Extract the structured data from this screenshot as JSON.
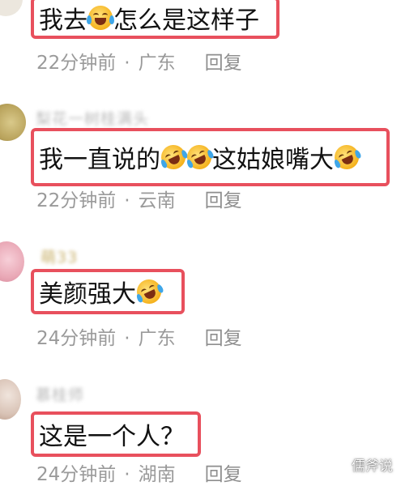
{
  "comments": [
    {
      "username": "",
      "text_before": "我去",
      "text_after": "怎么是这样子",
      "time": "22分钟前",
      "location": "广东",
      "reply_label": "回复"
    },
    {
      "username": "梨花一树桂满头",
      "text_before": "我一直说的",
      "text_after": "这姑娘嘴大",
      "time": "22分钟前",
      "location": "云南",
      "reply_label": "回复"
    },
    {
      "username": "萌33",
      "text_before": "美颜强大",
      "text_after": "",
      "time": "24分钟前",
      "location": "广东",
      "reply_label": "回复"
    },
    {
      "username": "慕桂师",
      "text_before": "这是一个人？",
      "text_after": "",
      "time": "24分钟前",
      "location": "湖南",
      "reply_label": "回复"
    }
  ],
  "separator": "·",
  "watermark": "儒斧说",
  "icons": [
    "laughing-crying-emoji",
    "rofl-emoji"
  ],
  "colors": {
    "highlight_border": "#e8505d",
    "meta_text": "#9a9a9a"
  }
}
